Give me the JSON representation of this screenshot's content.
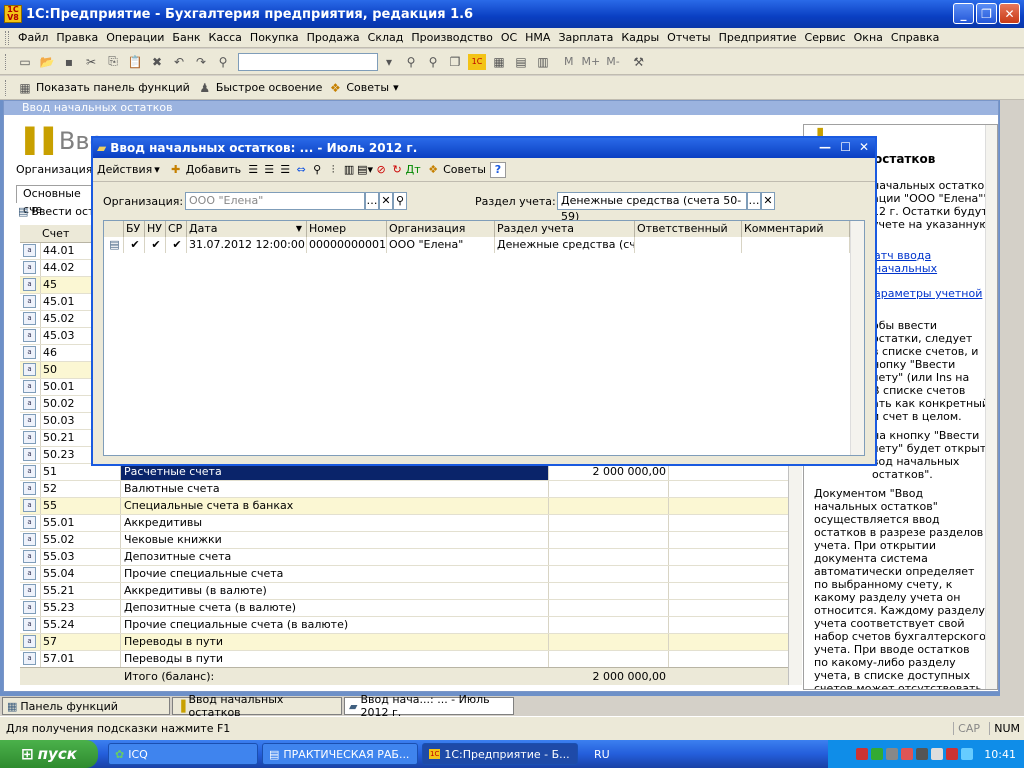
{
  "app": {
    "title": "1С:Предприятие - Бухгалтерия предприятия, редакция 1.6",
    "icon_text": "1С V8"
  },
  "menu": [
    "Файл",
    "Правка",
    "Операции",
    "Банк",
    "Касса",
    "Покупка",
    "Продажа",
    "Склад",
    "Производство",
    "ОС",
    "НМА",
    "Зарплата",
    "Кадры",
    "Отчеты",
    "Предприятие",
    "Сервис",
    "Окна",
    "Справка"
  ],
  "funcbar": {
    "show_panel": "Показать панель функций",
    "quick": "Быстрое освоение",
    "tips": "Советы"
  },
  "toolbar2": {
    "m": "M",
    "mplus": "M+",
    "mminus": "M-"
  },
  "docwin": {
    "caption": "Ввод начальных остатков",
    "big_title": "Ввод",
    "org_label": "Организация:",
    "tab_label": "Основные сче",
    "enter_btn": "Ввести ост",
    "col_account": "Счет",
    "rows": [
      {
        "acc": "44.01",
        "name": "",
        "sum": "",
        "yel": false
      },
      {
        "acc": "44.02",
        "name": "",
        "sum": "",
        "yel": false
      },
      {
        "acc": "45",
        "name": "",
        "sum": "",
        "yel": true
      },
      {
        "acc": "45.01",
        "name": "",
        "sum": "",
        "yel": false
      },
      {
        "acc": "45.02",
        "name": "",
        "sum": "",
        "yel": false
      },
      {
        "acc": "45.03",
        "name": "",
        "sum": "",
        "yel": false
      },
      {
        "acc": "46",
        "name": "",
        "sum": "",
        "yel": false
      },
      {
        "acc": "50",
        "name": "",
        "sum": "",
        "yel": true
      },
      {
        "acc": "50.01",
        "name": "",
        "sum": "",
        "yel": false
      },
      {
        "acc": "50.02",
        "name": "",
        "sum": "",
        "yel": false
      },
      {
        "acc": "50.03",
        "name": "",
        "sum": "",
        "yel": false
      },
      {
        "acc": "50.21",
        "name": "",
        "sum": "",
        "yel": false
      },
      {
        "acc": "50.23",
        "name": "",
        "sum": "",
        "yel": false
      },
      {
        "acc": "51",
        "name": "Расчетные счета",
        "sum": "2 000 000,00",
        "yel": false,
        "sel": true
      },
      {
        "acc": "52",
        "name": "Валютные счета",
        "sum": "",
        "yel": false
      },
      {
        "acc": "55",
        "name": "Специальные счета в банках",
        "sum": "",
        "yel": true
      },
      {
        "acc": "55.01",
        "name": "Аккредитивы",
        "sum": "",
        "yel": false
      },
      {
        "acc": "55.02",
        "name": "Чековые книжки",
        "sum": "",
        "yel": false
      },
      {
        "acc": "55.03",
        "name": "Депозитные счета",
        "sum": "",
        "yel": false
      },
      {
        "acc": "55.04",
        "name": "Прочие специальные счета",
        "sum": "",
        "yel": false
      },
      {
        "acc": "55.21",
        "name": "Аккредитивы (в валюте)",
        "sum": "",
        "yel": false
      },
      {
        "acc": "55.23",
        "name": "Депозитные счета (в валюте)",
        "sum": "",
        "yel": false
      },
      {
        "acc": "55.24",
        "name": "Прочие специальные счета (в валюте)",
        "sum": "",
        "yel": false
      },
      {
        "acc": "57",
        "name": "Переводы в пути",
        "sum": "",
        "yel": true
      },
      {
        "acc": "57.01",
        "name": "Переводы в пути",
        "sum": "",
        "yel": false
      }
    ],
    "total_label": "Итого (баланс):",
    "total_sum": "2 000 000,00"
  },
  "dialog": {
    "title": "Ввод начальных остатков: ... - Июль 2012 г.",
    "actions": "Действия",
    "add": "Добавить",
    "tips": "Советы",
    "org_label": "Организация:",
    "org_value": "ООО \"Елена\"",
    "section_label": "Раздел учета:",
    "section_value": "Денежные средства (счета 50-59)",
    "columns": [
      "БУ",
      "НУ",
      "СР",
      "Дата",
      "Номер",
      "Организация",
      "Раздел учета",
      "Ответственный",
      "Комментарий"
    ],
    "row": {
      "date": "31.07.2012 12:00:00",
      "number": "00000000001",
      "org": "ООО \"Елена\"",
      "section": "Денежные средства (сче...",
      "resp": "",
      "comment": ""
    }
  },
  "help": {
    "heading": "остатков",
    "lines1": [
      "начальных остатков",
      "ации \"ООО \"Елена\"\"",
      "12 г. Остатки будут",
      "учете на указанную"
    ],
    "link1": "атч ввода начальных",
    "link2": "араметры учетной",
    "lines2": [
      "обы ввести",
      "остатки, следует",
      "в списке счетов, и",
      "нопку \"Ввести",
      "чету\" (или Ins на",
      "В списке счетов",
      "ать как конкретный",
      "и счет в целом."
    ],
    "lines3": [
      "на кнопку \"Ввести",
      "чету\" будет открыт",
      "вод начальных",
      "остатков\"."
    ],
    "para": "Документом \"Ввод начальных остатков\" осуществляется ввод остатков в разрезе разделов учета. При открытии документа система автоматически определяет по выбранному счету, к какому разделу учета он относится. Каждому разделу учета соответствует свой набор счетов бухгалтерского учета. При вводе остатков по какому-либо разделу учета, в списке доступных счетов может отсутствовать субсчет, по которому требуется ввести остатки (также возможно одн"
  },
  "tabs": [
    "Панель функций",
    "Ввод начальных остатков",
    "Ввод нача...: ... - Июль 2012 г."
  ],
  "status": {
    "hint": "Для получения подсказки нажмите F1",
    "cap": "CAP",
    "num": "NUM"
  },
  "taskbar": {
    "start": "пуск",
    "items": [
      "ICQ",
      "ПРАКТИЧЕСКАЯ РАБ...",
      "1С:Предприятие - Б..."
    ],
    "lang": "RU",
    "time": "10:41"
  }
}
